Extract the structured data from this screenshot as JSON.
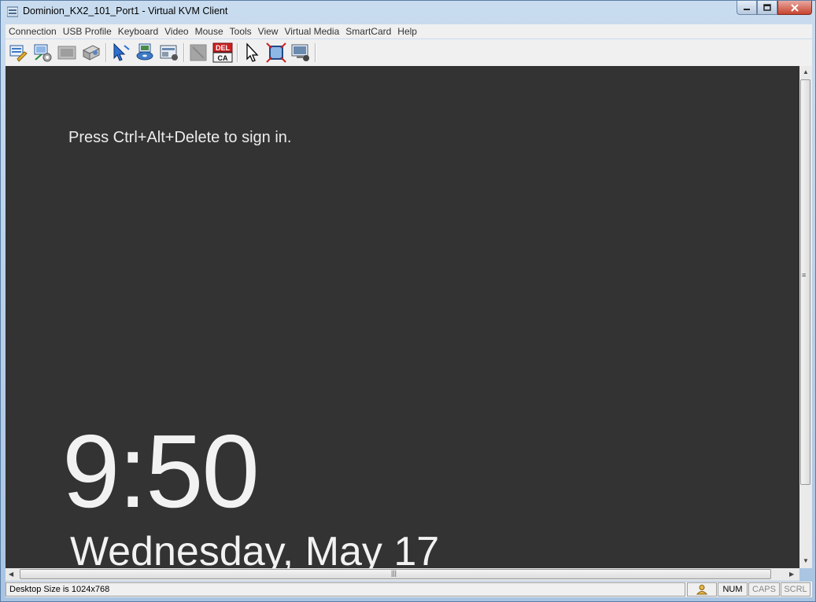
{
  "window": {
    "title": "Dominion_KX2_101_Port1 - Virtual KVM Client"
  },
  "menu": [
    "Connection",
    "USB Profile",
    "Keyboard",
    "Video",
    "Mouse",
    "Tools",
    "View",
    "Virtual Media",
    "SmartCard",
    "Help"
  ],
  "toolbar": {
    "icons": [
      "connection-properties-icon",
      "usb-profile-icon",
      "video-settings-icon",
      "color-calibration-icon",
      "sync-mouse-icon",
      "virtual-media-icon",
      "smart-card-icon",
      "disabled-icon",
      "send-ctrl-alt-del-icon",
      "single-cursor-icon",
      "full-screen-icon",
      "scaling-icon"
    ],
    "cad_label_top": "DEL",
    "cad_label_bottom": "CA"
  },
  "screen": {
    "prompt": "Press Ctrl+Alt+Delete to sign in.",
    "time": "9:50",
    "date": "Wednesday, May 17"
  },
  "status": {
    "message": "Desktop Size is 1024x768",
    "num": "NUM",
    "caps": "CAPS",
    "scrl": "SCRL"
  },
  "colors": {
    "screen_bg": "#333333",
    "accent_red": "#cc2222"
  }
}
